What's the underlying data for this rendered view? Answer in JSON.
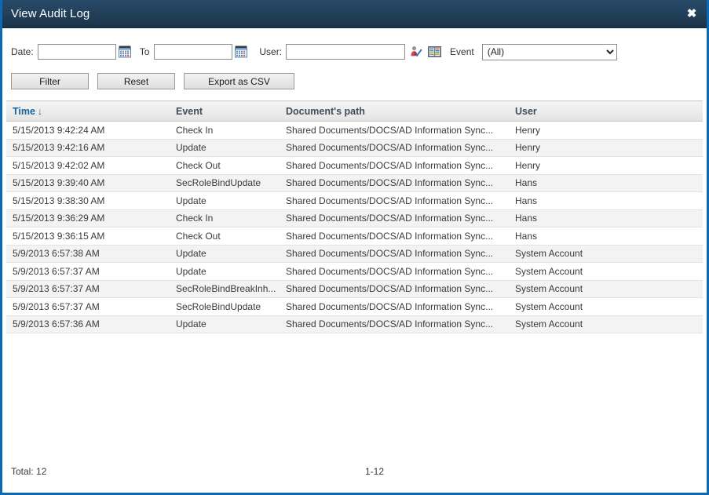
{
  "window": {
    "title": "View Audit Log",
    "close_label": "✖",
    "accent_border_color": "#0a6ab5",
    "titlebar_color": "#23415c"
  },
  "filters": {
    "date_label": "Date:",
    "date_from_value": "",
    "date_from_placeholder": "",
    "to_label": "To",
    "date_to_value": "",
    "date_to_placeholder": "",
    "calendar_icon_from": "calendar-icon",
    "calendar_icon_to": "calendar-icon",
    "user_label": "User:",
    "user_value": "",
    "user_placeholder": "",
    "check_names_icon": "check-names-icon",
    "address_book_icon": "address-book-icon",
    "event_label": "Event",
    "event_selected": "(All)",
    "event_options": [
      "(All)"
    ]
  },
  "actions": {
    "filter_label": "Filter",
    "reset_label": "Reset",
    "export_label": "Export as CSV"
  },
  "table": {
    "columns": [
      {
        "key": "time",
        "label": "Time",
        "sorted": true,
        "sort_arrow": "↓"
      },
      {
        "key": "event",
        "label": "Event",
        "sorted": false,
        "sort_arrow": ""
      },
      {
        "key": "path",
        "label": "Document's path",
        "sorted": false,
        "sort_arrow": ""
      },
      {
        "key": "user",
        "label": "User",
        "sorted": false,
        "sort_arrow": ""
      }
    ],
    "rows": [
      {
        "time": "5/15/2013 9:42:24 AM",
        "event": "Check In",
        "path": "Shared Documents/DOCS/AD Information Sync...",
        "user": "Henry"
      },
      {
        "time": "5/15/2013 9:42:16 AM",
        "event": "Update",
        "path": "Shared Documents/DOCS/AD Information Sync...",
        "user": "Henry"
      },
      {
        "time": "5/15/2013 9:42:02 AM",
        "event": "Check Out",
        "path": "Shared Documents/DOCS/AD Information Sync...",
        "user": "Henry"
      },
      {
        "time": "5/15/2013 9:39:40 AM",
        "event": "SecRoleBindUpdate",
        "path": "Shared Documents/DOCS/AD Information Sync...",
        "user": "Hans"
      },
      {
        "time": "5/15/2013 9:38:30 AM",
        "event": "Update",
        "path": "Shared Documents/DOCS/AD Information Sync...",
        "user": "Hans"
      },
      {
        "time": "5/15/2013 9:36:29 AM",
        "event": "Check In",
        "path": "Shared Documents/DOCS/AD Information Sync...",
        "user": "Hans"
      },
      {
        "time": "5/15/2013 9:36:15 AM",
        "event": "Check Out",
        "path": "Shared Documents/DOCS/AD Information Sync...",
        "user": "Hans"
      },
      {
        "time": "5/9/2013 6:57:38 AM",
        "event": "Update",
        "path": "Shared Documents/DOCS/AD Information Sync...",
        "user": "System Account"
      },
      {
        "time": "5/9/2013 6:57:37 AM",
        "event": "Update",
        "path": "Shared Documents/DOCS/AD Information Sync...",
        "user": "System Account"
      },
      {
        "time": "5/9/2013 6:57:37 AM",
        "event": "SecRoleBindBreakInh...",
        "path": "Shared Documents/DOCS/AD Information Sync...",
        "user": "System Account"
      },
      {
        "time": "5/9/2013 6:57:37 AM",
        "event": "SecRoleBindUpdate",
        "path": "Shared Documents/DOCS/AD Information Sync...",
        "user": "System Account"
      },
      {
        "time": "5/9/2013 6:57:36 AM",
        "event": "Update",
        "path": "Shared Documents/DOCS/AD Information Sync...",
        "user": "System Account"
      }
    ]
  },
  "footer": {
    "total_label": "Total: 12",
    "range_label": "1-12"
  }
}
